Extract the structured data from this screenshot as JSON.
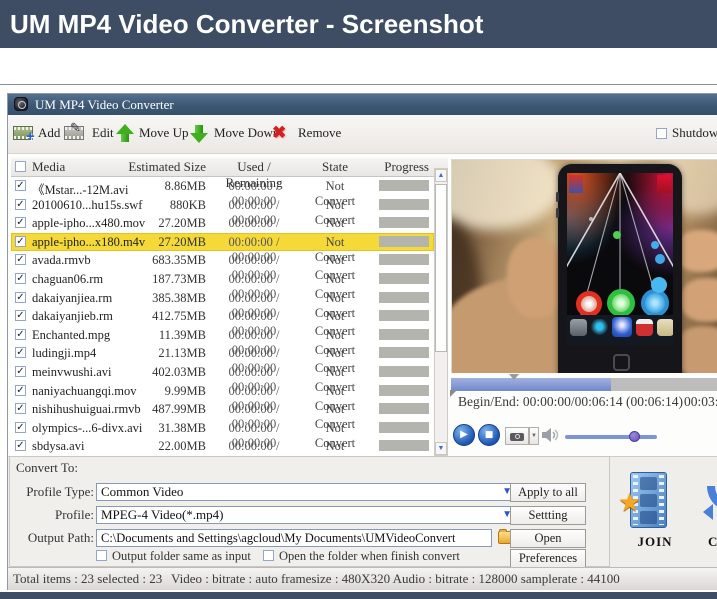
{
  "page": {
    "header_title": "UM MP4 Video Converter - Screenshot"
  },
  "colors": {
    "site_bar": "#3e4d63",
    "title_bar": "#41597a",
    "accent_blue": "#2f55cc",
    "highlight_row": "#f5d939",
    "progress_gray": "#b4b4af",
    "green_arrow": "#3fae1f",
    "remove_red": "#d02020",
    "join_star": "#f5a623"
  },
  "icons": {
    "check": "✓",
    "dropdown": "▼",
    "scroll_up": "▲",
    "scroll_down": "▼",
    "play": "▶",
    "stop": "■",
    "remove": "✖",
    "plus": "+",
    "pencil": "✎",
    "star": "★"
  },
  "window": {
    "title": "UM MP4 Video Converter",
    "toolbar": {
      "add": "Add",
      "edit": "Edit",
      "move_up": "Move Up",
      "move_down": "Move Down",
      "remove": "Remove",
      "shutdown": "Shutdown"
    },
    "file_list": {
      "columns": [
        "Media",
        "Estimated Size",
        "Used / Remaining",
        "State",
        "Progress"
      ],
      "rows": [
        {
          "name": "《Mstar...-12M.avi",
          "size": "8.86MB",
          "used": "00:00:00 / 00:00:00",
          "state": "Not Convert",
          "checked": true,
          "highlighted": false
        },
        {
          "name": "20100610...hu15s.swf",
          "size": "880KB",
          "used": "00:00:00 / 00:00:00",
          "state": "Not Convert",
          "checked": true,
          "highlighted": false
        },
        {
          "name": "apple-ipho...x480.mov",
          "size": "27.20MB",
          "used": "00:00:00 / 00:00:00",
          "state": "Not Convert",
          "checked": true,
          "highlighted": false
        },
        {
          "name": "apple-ipho...x180.m4v",
          "size": "27.20MB",
          "used": "00:00:00 / 00:00:00",
          "state": "Not Convert",
          "checked": true,
          "highlighted": true
        },
        {
          "name": "avada.rmvb",
          "size": "683.35MB",
          "used": "00:00:00 / 00:00:00",
          "state": "Not Convert",
          "checked": true,
          "highlighted": false
        },
        {
          "name": "chaguan06.rm",
          "size": "187.73MB",
          "used": "00:00:00 / 00:00:00",
          "state": "Not Convert",
          "checked": true,
          "highlighted": false
        },
        {
          "name": "dakaiyanjiea.rm",
          "size": "385.38MB",
          "used": "00:00:00 / 00:00:00",
          "state": "Not Convert",
          "checked": true,
          "highlighted": false
        },
        {
          "name": "dakaiyanjieb.rm",
          "size": "412.75MB",
          "used": "00:00:00 / 00:00:00",
          "state": "Not Convert",
          "checked": true,
          "highlighted": false
        },
        {
          "name": "Enchanted.mpg",
          "size": "11.39MB",
          "used": "00:00:00 / 00:00:00",
          "state": "Not Convert",
          "checked": true,
          "highlighted": false
        },
        {
          "name": "ludingji.mp4",
          "size": "21.13MB",
          "used": "00:00:00 / 00:00:00",
          "state": "Not Convert",
          "checked": true,
          "highlighted": false
        },
        {
          "name": "meinvwushi.avi",
          "size": "402.03MB",
          "used": "00:00:00 / 00:00:00",
          "state": "Not Convert",
          "checked": true,
          "highlighted": false
        },
        {
          "name": "naniyachuangqi.mov",
          "size": "9.99MB",
          "used": "00:00:00 / 00:00:00",
          "state": "Not Convert",
          "checked": true,
          "highlighted": false
        },
        {
          "name": "nishihushuiguai.rmvb",
          "size": "487.99MB",
          "used": "00:00:00 / 00:00:00",
          "state": "Not Convert",
          "checked": true,
          "highlighted": false
        },
        {
          "name": "olympics-...6-divx.avi",
          "size": "31.38MB",
          "used": "00:00:00 / 00:00:00",
          "state": "Not Convert",
          "checked": true,
          "highlighted": false
        },
        {
          "name": "sbdysa.avi",
          "size": "22.00MB",
          "used": "00:00:00 / 00:00:00",
          "state": "Not Convert",
          "checked": true,
          "highlighted": false
        }
      ]
    },
    "preview": {
      "begin_end_label": "Begin/End: 00:00:00/00:06:14 (00:06:14)",
      "current_time": "00:03:"
    },
    "convert_panel": {
      "group_label": "Convert To:",
      "profile_type_label": "Profile Type:",
      "profile_type_value": "Common Video",
      "profile_label": "Profile:",
      "profile_value": "MPEG-4 Video(*.mp4)",
      "output_path_label": "Output Path:",
      "output_path_value": "C:\\Documents and Settings\\agcloud\\My Documents\\UMVideoConvert",
      "checkbox_same_folder": "Output folder same as input",
      "checkbox_open_folder": "Open the folder when finish convert",
      "apply_button": "Apply to all",
      "setting_button": "Settting",
      "open_button": "Open",
      "preferences_button": "Preferences",
      "join_button": "JOIN",
      "convert_button": "CO"
    },
    "status_bar": {
      "left": "Total items : 23  selected : 23",
      "right": "Video : bitrate : auto framesize : 480X320  Audio : bitrate : 128000 samplerate : 44100"
    }
  }
}
